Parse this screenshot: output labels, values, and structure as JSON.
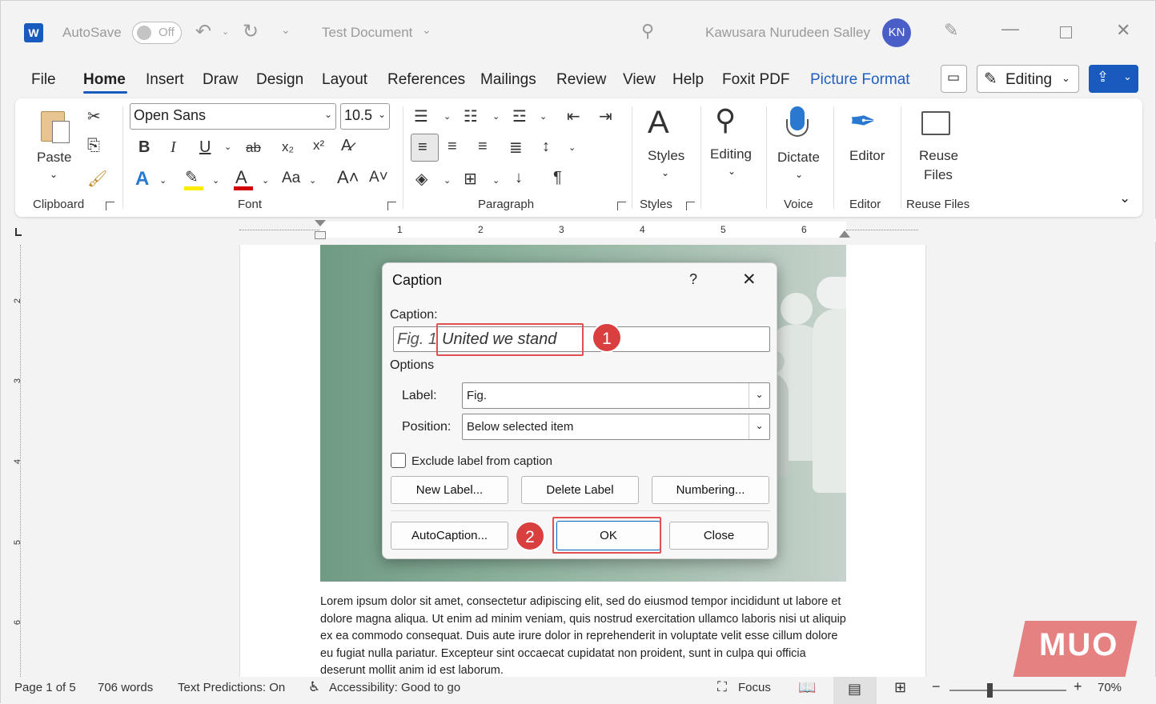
{
  "titlebar": {
    "autosave_label": "AutoSave",
    "autosave_state": "Off",
    "document_title": "Test Document",
    "user_name": "Kawusara Nurudeen Salley",
    "user_initials": "KN"
  },
  "menu": {
    "tabs": [
      "File",
      "Home",
      "Insert",
      "Draw",
      "Design",
      "Layout",
      "References",
      "Mailings",
      "Review",
      "View",
      "Help",
      "Foxit PDF",
      "Picture Format"
    ],
    "active_tab": "Home",
    "editing_label": "Editing"
  },
  "ribbon": {
    "clipboard": {
      "paste_label": "Paste",
      "group_label": "Clipboard"
    },
    "font": {
      "font_name": "Open Sans",
      "font_size": "10.5",
      "group_label": "Font",
      "case_label": "Aa"
    },
    "paragraph": {
      "group_label": "Paragraph"
    },
    "styles": {
      "button_label": "Styles",
      "group_label": "Styles"
    },
    "editing": {
      "button_label": "Editing"
    },
    "voice": {
      "button_label": "Dictate",
      "group_label": "Voice"
    },
    "editor": {
      "button_label": "Editor",
      "group_label": "Editor"
    },
    "reuse": {
      "button_label_1": "Reuse",
      "button_label_2": "Files",
      "group_label": "Reuse Files"
    }
  },
  "ruler": {
    "h_numbers": [
      "1",
      "2",
      "3",
      "4",
      "5",
      "6"
    ],
    "v_numbers": [
      "2",
      "3",
      "4",
      "5",
      "6"
    ]
  },
  "document": {
    "body_text": "Lorem ipsum dolor sit amet, consectetur adipiscing elit, sed do eiusmod tempor incididunt ut labore et dolore magna aliqua. Ut enim ad minim veniam, quis nostrud exercitation ullamco laboris nisi ut aliquip ex ea commodo consequat. Duis aute irure dolor in reprehenderit in voluptate velit esse cillum dolore eu fugiat nulla pariatur. Excepteur sint occaecat cupidatat non proident, sunt in culpa qui officia deserunt mollit anim id est laborum."
  },
  "dialog": {
    "title": "Caption",
    "help": "?",
    "caption_label": "Caption:",
    "caption_prefix": "Fig. 1",
    "caption_value": "United we stand",
    "options_label": "Options",
    "label_label": "Label:",
    "label_value": "Fig.",
    "position_label": "Position:",
    "position_value": "Below selected item",
    "exclude_label": "Exclude label from caption",
    "new_label_btn": "New Label...",
    "delete_label_btn": "Delete Label",
    "numbering_btn": "Numbering...",
    "autocaption_btn": "AutoCaption...",
    "ok_btn": "OK",
    "close_btn": "Close"
  },
  "annotations": {
    "badge1": "1",
    "badge2": "2"
  },
  "status": {
    "page": "Page 1 of 5",
    "words": "706 words",
    "text_predictions": "Text Predictions: On",
    "accessibility": "Accessibility: Good to go",
    "focus": "Focus",
    "zoom": "70%"
  },
  "watermark": "MUO",
  "colors": {
    "accent": "#185abd",
    "highlight_red": "#e05050",
    "badge_red": "#d93f3f"
  }
}
